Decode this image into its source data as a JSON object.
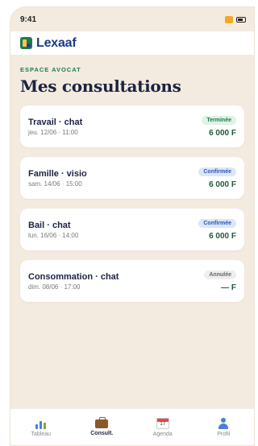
{
  "status_bar": {
    "time": "9:41"
  },
  "brand": {
    "name": "Lexaaf"
  },
  "header": {
    "section_label": "ESPACE AVOCAT",
    "title": "Mes consultations"
  },
  "consultations": [
    {
      "title": "Travail · chat",
      "datetime": "jeu. 12/06 · 11:00",
      "status": "Terminée",
      "price": "6 000 F"
    },
    {
      "title": "Famille · visio",
      "datetime": "sam. 14/06 · 15:00",
      "status": "Confirmée",
      "price": "6 000 F"
    },
    {
      "title": "Bail · chat",
      "datetime": "lun. 16/06 · 14:00",
      "status": "Confirmée",
      "price": "6 000 F"
    },
    {
      "title": "Consommation · chat",
      "datetime": "dim. 08/06 · 17:00",
      "status": "Annulée",
      "price": "— F"
    }
  ],
  "tabbar": {
    "items": [
      {
        "label": "Tableau",
        "icon": "chart-icon"
      },
      {
        "label": "Consult.",
        "icon": "briefcase-icon",
        "active": true
      },
      {
        "label": "Agenda",
        "icon": "calendar-icon",
        "calendar_day": "17"
      },
      {
        "label": "Profil",
        "icon": "user-icon"
      }
    ]
  },
  "colors": {
    "background": "#f3ebe0",
    "brand_blue": "#1a3a8c",
    "accent_green": "#1f7a4d",
    "confirmed_blue": "#2a56b8"
  }
}
